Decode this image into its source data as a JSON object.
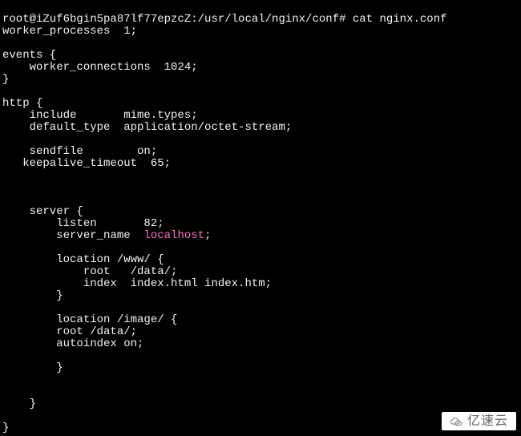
{
  "terminal": {
    "prompt": "root@iZuf6bgin5pa87lf77epzcZ:/usr/local/nginx/conf# ",
    "command": "cat nginx.conf",
    "lines": [
      "worker_processes  1;",
      "",
      "events {",
      "    worker_connections  1024;",
      "}",
      "",
      "http {",
      "    include       mime.types;",
      "    default_type  application/octet-stream;",
      "",
      "    sendfile        on;",
      "   keepalive_timeout  65;",
      "",
      "",
      "",
      "    server {",
      "        listen       82;",
      "        server_name  ",
      ";",
      "",
      "        location /www/ {",
      "            root   /data/;",
      "            index  index.html index.htm;",
      "        }",
      "",
      "        location /image/ {",
      "        root /data/;",
      "        autoindex on;",
      "",
      "        }",
      "",
      "",
      "    }",
      "",
      "}"
    ],
    "highlight": "localhost"
  },
  "watermark": {
    "text": "亿速云"
  }
}
